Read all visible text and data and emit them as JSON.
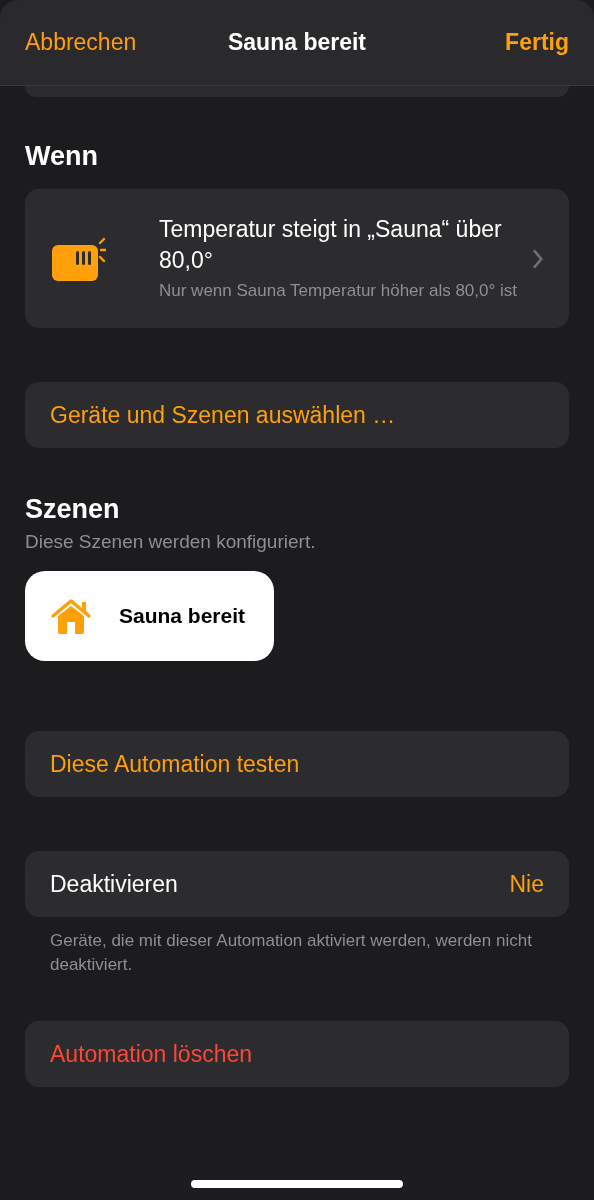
{
  "nav": {
    "cancel": "Abbrechen",
    "title": "Sauna bereit",
    "done": "Fertig"
  },
  "when": {
    "heading": "Wenn",
    "trigger": {
      "title": "Temperatur steigt in „Sauna“ über 80,0°",
      "subtitle": "Nur wenn Sauna Temperatur höher als 80,0° ist"
    }
  },
  "choose_button": "Geräte und Szenen auswählen …",
  "scenes": {
    "heading": "Szenen",
    "subtitle": "Diese Szenen werden konfiguriert.",
    "items": [
      {
        "name": "Sauna bereit",
        "selected": true
      }
    ]
  },
  "test_button": "Diese Automation testen",
  "deactivate": {
    "label": "Deaktivieren",
    "value": "Nie",
    "footnote": "Geräte, die mit dieser Automation aktiviert werden, werden nicht deaktiviert."
  },
  "delete_button": "Automation löschen"
}
